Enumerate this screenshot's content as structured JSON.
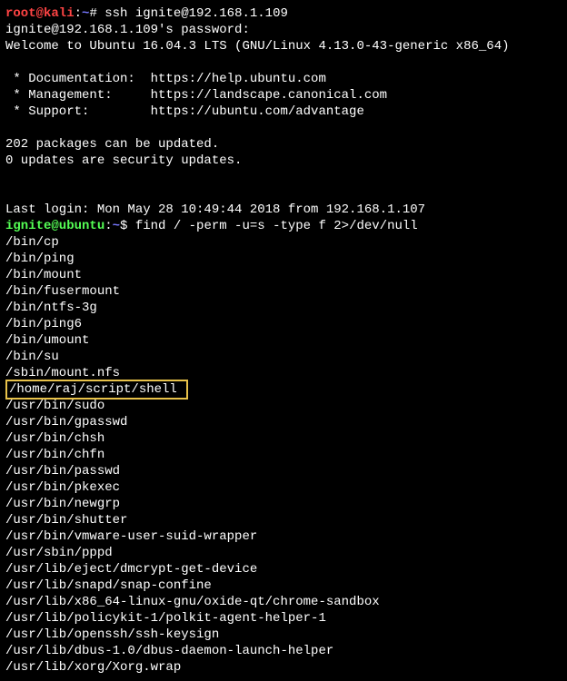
{
  "prompt1": {
    "user": "root@kali",
    "sep": ":",
    "path": "~",
    "symbol": "#",
    "command": " ssh ignite@192.168.1.109"
  },
  "pwline": "ignite@192.168.1.109's password:",
  "welcome": "Welcome to Ubuntu 16.04.3 LTS (GNU/Linux 4.13.0-43-generic x86_64)",
  "blank": " ",
  "doc": " * Documentation:  https://help.ubuntu.com",
  "mgmt": " * Management:     https://landscape.canonical.com",
  "sup": " * Support:        https://ubuntu.com/advantage",
  "pkg1": "202 packages can be updated.",
  "pkg2": "0 updates are security updates.",
  "lastlogin": "Last login: Mon May 28 10:49:44 2018 from 192.168.1.107",
  "prompt2": {
    "user": "ignite@ubuntu",
    "sep": ":",
    "path": "~",
    "symbol": "$",
    "command": " find / -perm -u=s -type f 2>/dev/null"
  },
  "results": [
    "/bin/cp",
    "/bin/ping",
    "/bin/mount",
    "/bin/fusermount",
    "/bin/ntfs-3g",
    "/bin/ping6",
    "/bin/umount",
    "/bin/su",
    "/sbin/mount.nfs"
  ],
  "highlighted_result": "/home/raj/script/shell ",
  "results2": [
    "/usr/bin/sudo",
    "/usr/bin/gpasswd",
    "/usr/bin/chsh",
    "/usr/bin/chfn",
    "/usr/bin/passwd",
    "/usr/bin/pkexec",
    "/usr/bin/newgrp",
    "/usr/bin/shutter",
    "/usr/bin/vmware-user-suid-wrapper",
    "/usr/sbin/pppd",
    "/usr/lib/eject/dmcrypt-get-device",
    "/usr/lib/snapd/snap-confine",
    "/usr/lib/x86_64-linux-gnu/oxide-qt/chrome-sandbox",
    "/usr/lib/policykit-1/polkit-agent-helper-1",
    "/usr/lib/openssh/ssh-keysign",
    "/usr/lib/dbus-1.0/dbus-daemon-launch-helper",
    "/usr/lib/xorg/Xorg.wrap"
  ]
}
